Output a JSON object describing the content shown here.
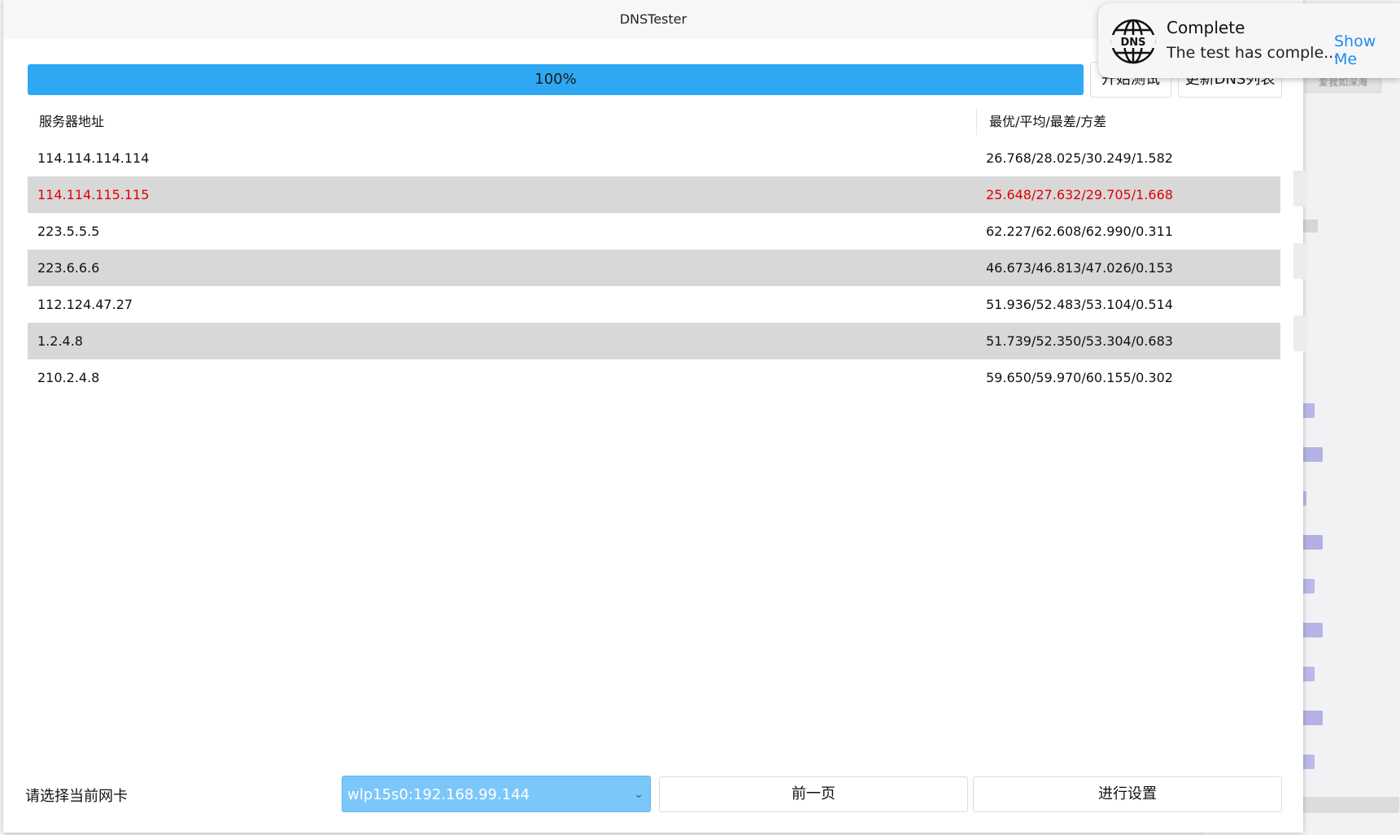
{
  "window": {
    "title": "DNSTester"
  },
  "progress": {
    "value": 1.0,
    "label": "100%",
    "color": "#2ea8f3"
  },
  "toolbar": {
    "start_label": "开始测试",
    "update_label": "更新DNS列表"
  },
  "table": {
    "headers": {
      "address": "服务器地址",
      "stats": "最优/平均/最差/方差"
    },
    "rows": [
      {
        "address": "114.114.114.114",
        "stats": "26.768/28.025/30.249/1.582"
      },
      {
        "address": "114.114.115.115",
        "stats": "25.648/27.632/29.705/1.668",
        "highlight": true
      },
      {
        "address": "223.5.5.5",
        "stats": "62.227/62.608/62.990/0.311"
      },
      {
        "address": "223.6.6.6",
        "stats": "46.673/46.813/47.026/0.153"
      },
      {
        "address": "112.124.47.27",
        "stats": "51.936/52.483/53.104/0.514"
      },
      {
        "address": "1.2.4.8",
        "stats": "51.739/52.350/53.304/0.683"
      },
      {
        "address": "210.2.4.8",
        "stats": "59.650/59.970/60.155/0.302"
      }
    ]
  },
  "footer": {
    "nic_label": "请选择当前网卡",
    "nic_selected": "wlp15s0:192.168.99.144",
    "prev_label": "前一页",
    "settings_label": "进行设置"
  },
  "notification": {
    "title": "Complete",
    "body": "The test has comple...",
    "action": "Show Me",
    "icon": "dns-globe-icon"
  },
  "background": {
    "badge_text": "爱我如深海"
  },
  "colors": {
    "highlight_text": "#e00000",
    "alt_row": "#d8d8d8",
    "select_bg": "#7cc7f9"
  }
}
